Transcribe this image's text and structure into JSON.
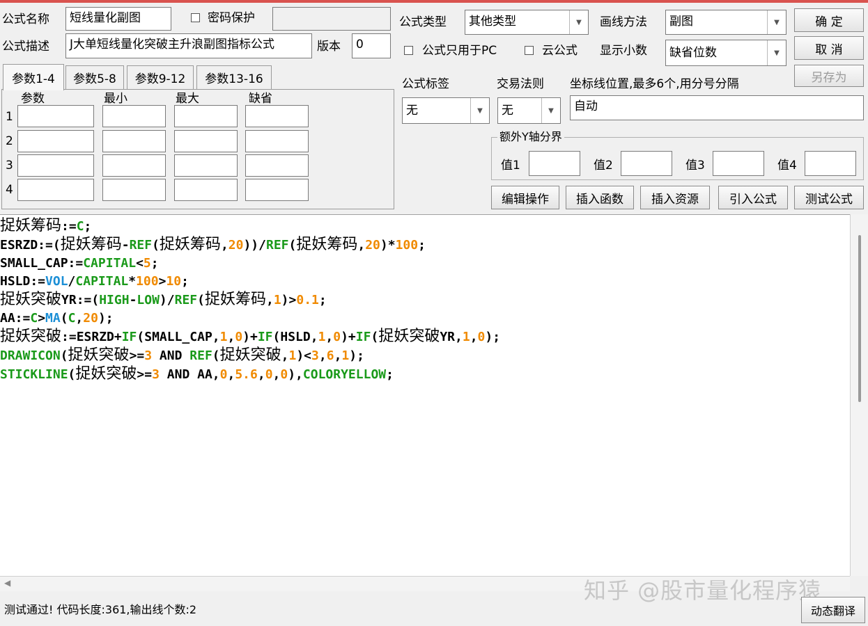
{
  "formula": {
    "name_label": "公式名称",
    "name_value": "短线量化副图",
    "password_label": "密码保护",
    "password_value": "",
    "desc_label": "公式描述",
    "desc_value": "J大单短线量化突破主升浪副图指标公式",
    "version_label": "版本",
    "version_value": "0"
  },
  "right_top": {
    "type_label": "公式类型",
    "type_value": "其他类型",
    "draw_label": "画线方法",
    "draw_value": "副图",
    "pc_only_label": "公式只用于PC",
    "cloud_label": "云公式",
    "decimals_label": "显示小数",
    "decimals_value": "缺省位数",
    "tag_label": "公式标签",
    "tag_value": "无",
    "rule_label": "交易法则",
    "rule_value": "无",
    "axis_label": "坐标线位置,最多6个,用分号分隔",
    "axis_value": "自动",
    "extra_y_label": "额外Y轴分界",
    "v1_label": "值1",
    "v2_label": "值2",
    "v3_label": "值3",
    "v4_label": "值4"
  },
  "buttons": {
    "ok": "确  定",
    "cancel": "取  消",
    "save_as": "另存为",
    "edit_ops": "编辑操作",
    "insert_func": "插入函数",
    "insert_res": "插入资源",
    "import": "引入公式",
    "test": "测试公式",
    "translate": "动态翻译"
  },
  "param_tabs": [
    "参数1-4",
    "参数5-8",
    "参数9-12",
    "参数13-16"
  ],
  "param_headers": [
    "参数",
    "最小",
    "最大",
    "缺省"
  ],
  "param_rows": [
    "1",
    "2",
    "3",
    "4"
  ],
  "code_lines": [
    [
      [
        "k",
        "捉妖筹码"
      ],
      [
        "k",
        ":="
      ],
      [
        "g",
        "C"
      ],
      [
        "k",
        ";"
      ]
    ],
    [
      [
        "k",
        "ESRZD:=("
      ],
      [
        "k",
        "捉妖筹码"
      ],
      [
        "k",
        "-"
      ],
      [
        "g",
        "REF"
      ],
      [
        "k",
        "("
      ],
      [
        "k",
        "捉妖筹码"
      ],
      [
        "k",
        ","
      ],
      [
        "o",
        "20"
      ],
      [
        "k",
        "))/"
      ],
      [
        "g",
        "REF"
      ],
      [
        "k",
        "("
      ],
      [
        "k",
        "捉妖筹码"
      ],
      [
        "k",
        ","
      ],
      [
        "o",
        "20"
      ],
      [
        "k",
        ")*"
      ],
      [
        "o",
        "100"
      ],
      [
        "k",
        ";"
      ]
    ],
    [
      [
        "k",
        "SMALL_CAP:="
      ],
      [
        "g",
        "CAPITAL"
      ],
      [
        "k",
        "<"
      ],
      [
        "o",
        "5"
      ],
      [
        "k",
        ";"
      ]
    ],
    [
      [
        "k",
        "HSLD:="
      ],
      [
        "b",
        "VOL"
      ],
      [
        "k",
        "/"
      ],
      [
        "g",
        "CAPITAL"
      ],
      [
        "k",
        "*"
      ],
      [
        "o",
        "100"
      ],
      [
        "k",
        ">"
      ],
      [
        "o",
        "10"
      ],
      [
        "k",
        ";"
      ]
    ],
    [
      [
        "k",
        "捉妖突破"
      ],
      [
        "k",
        "YR:=("
      ],
      [
        "g",
        "HIGH"
      ],
      [
        "k",
        "-"
      ],
      [
        "g",
        "LOW"
      ],
      [
        "k",
        ")/"
      ],
      [
        "g",
        "REF"
      ],
      [
        "k",
        "("
      ],
      [
        "k",
        "捉妖筹码"
      ],
      [
        "k",
        ","
      ],
      [
        "o",
        "1"
      ],
      [
        "k",
        ")>"
      ],
      [
        "o",
        "0.1"
      ],
      [
        "k",
        ";"
      ]
    ],
    [
      [
        "k",
        "AA:="
      ],
      [
        "g",
        "C"
      ],
      [
        "k",
        ">"
      ],
      [
        "b",
        "MA"
      ],
      [
        "k",
        "("
      ],
      [
        "g",
        "C"
      ],
      [
        "k",
        ","
      ],
      [
        "o",
        "20"
      ],
      [
        "k",
        ");"
      ]
    ],
    [
      [
        "k",
        "捉妖突破"
      ],
      [
        "k",
        ":=ESRZD+"
      ],
      [
        "g",
        "IF"
      ],
      [
        "k",
        "(SMALL_CAP,"
      ],
      [
        "o",
        "1"
      ],
      [
        "k",
        ","
      ],
      [
        "o",
        "0"
      ],
      [
        "k",
        ")+"
      ],
      [
        "g",
        "IF"
      ],
      [
        "k",
        "(HSLD,"
      ],
      [
        "o",
        "1"
      ],
      [
        "k",
        ","
      ],
      [
        "o",
        "0"
      ],
      [
        "k",
        ")+"
      ],
      [
        "g",
        "IF"
      ],
      [
        "k",
        "("
      ],
      [
        "k",
        "捉妖突破"
      ],
      [
        "k",
        "YR,"
      ],
      [
        "o",
        "1"
      ],
      [
        "k",
        ","
      ],
      [
        "o",
        "0"
      ],
      [
        "k",
        ");"
      ]
    ],
    [
      [
        "g",
        "DRAWICON"
      ],
      [
        "k",
        "("
      ],
      [
        "k",
        "捉妖突破"
      ],
      [
        "k",
        ">="
      ],
      [
        "o",
        "3"
      ],
      [
        "k",
        " AND "
      ],
      [
        "g",
        "REF"
      ],
      [
        "k",
        "("
      ],
      [
        "k",
        "捉妖突破"
      ],
      [
        "k",
        ","
      ],
      [
        "o",
        "1"
      ],
      [
        "k",
        ")<"
      ],
      [
        "o",
        "3"
      ],
      [
        "k",
        ","
      ],
      [
        "o",
        "6"
      ],
      [
        "k",
        ","
      ],
      [
        "o",
        "1"
      ],
      [
        "k",
        ");"
      ]
    ],
    [
      [
        "g",
        "STICKLINE"
      ],
      [
        "k",
        "("
      ],
      [
        "k",
        "捉妖突破"
      ],
      [
        "k",
        ">="
      ],
      [
        "o",
        "3"
      ],
      [
        "k",
        " AND AA,"
      ],
      [
        "o",
        "0"
      ],
      [
        "k",
        ","
      ],
      [
        "o",
        "5.6"
      ],
      [
        "k",
        ","
      ],
      [
        "o",
        "0"
      ],
      [
        "k",
        ","
      ],
      [
        "o",
        "0"
      ],
      [
        "k",
        "),"
      ],
      [
        "g",
        "COLORYELLOW"
      ],
      [
        "k",
        ";"
      ]
    ]
  ],
  "status_text": "测试通过! 代码长度:361,输出线个数:2",
  "watermark": "知乎 @股市量化程序猿"
}
